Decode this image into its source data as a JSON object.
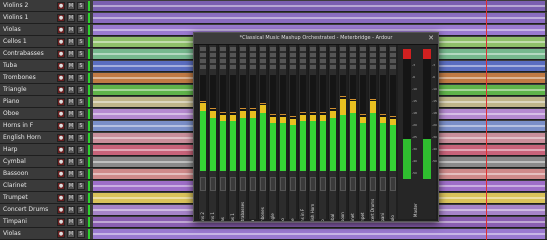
{
  "tracks": [
    {
      "name": "Violins 2",
      "lane_color": "#7a5fb0"
    },
    {
      "name": "Violins 1",
      "lane_color": "#8a6cc0"
    },
    {
      "name": "Violas",
      "lane_color": "#9a7ad0"
    },
    {
      "name": "Cellos 1",
      "lane_color": "#8fbf6a"
    },
    {
      "name": "Contrabasses",
      "lane_color": "#76b88e"
    },
    {
      "name": "Tuba",
      "lane_color": "#5a6dc0"
    },
    {
      "name": "Trombones",
      "lane_color": "#c07a44"
    },
    {
      "name": "Triangle",
      "lane_color": "#5fb34a"
    },
    {
      "name": "Piano",
      "lane_color": "#bfb58a"
    },
    {
      "name": "Oboe",
      "lane_color": "#b58ad0"
    },
    {
      "name": "Horns in F",
      "lane_color": "#7a8ec8"
    },
    {
      "name": "English Horn",
      "lane_color": "#c98f9b"
    },
    {
      "name": "Harp",
      "lane_color": "#c8637a"
    },
    {
      "name": "Cymbal",
      "lane_color": "#8a8a8a"
    },
    {
      "name": "Bassoon",
      "lane_color": "#cf8a8a"
    },
    {
      "name": "Clarinet",
      "lane_color": "#9e6ec8"
    },
    {
      "name": "Trumpet",
      "lane_color": "#d9c25a"
    },
    {
      "name": "Concert Drums",
      "lane_color": "#a684c8"
    },
    {
      "name": "Timpani",
      "lane_color": "#8a5fb0"
    },
    {
      "name": "Violas",
      "lane_color": "#9a7ad0"
    }
  ],
  "track_buttons": {
    "mute": "M",
    "solo": "S",
    "rec": "●"
  },
  "mixer": {
    "title": "*Classical Music Mashup Orchestrated - Meterbridge - Ardour",
    "close": "✕",
    "strips": [
      {
        "name": "Violins 2",
        "level": 0.62,
        "peak": 0.7
      },
      {
        "name": "Violins 1",
        "level": 0.55,
        "peak": 0.62
      },
      {
        "name": "Violas",
        "level": 0.52,
        "peak": 0.58
      },
      {
        "name": "Cellos 1",
        "level": 0.52,
        "peak": 0.58
      },
      {
        "name": "Contrabasses",
        "level": 0.55,
        "peak": 0.62
      },
      {
        "name": "Tuba",
        "level": 0.55,
        "peak": 0.62
      },
      {
        "name": "Trombones",
        "level": 0.6,
        "peak": 0.68
      },
      {
        "name": "Triangle",
        "level": 0.5,
        "peak": 0.56
      },
      {
        "name": "Piano",
        "level": 0.5,
        "peak": 0.56
      },
      {
        "name": "Oboe",
        "level": 0.48,
        "peak": 0.54
      },
      {
        "name": "Horns in F",
        "level": 0.52,
        "peak": 0.58
      },
      {
        "name": "English Horn",
        "level": 0.52,
        "peak": 0.58
      },
      {
        "name": "Harp",
        "level": 0.52,
        "peak": 0.58
      },
      {
        "name": "Cymbal",
        "level": 0.55,
        "peak": 0.62
      },
      {
        "name": "Bassoon",
        "level": 0.58,
        "peak": 0.75
      },
      {
        "name": "Clarinet",
        "level": 0.6,
        "peak": 0.72
      },
      {
        "name": "Trumpet",
        "level": 0.5,
        "peak": 0.56
      },
      {
        "name": "Concert Drums",
        "level": 0.6,
        "peak": 0.72
      },
      {
        "name": "Timpani",
        "level": 0.5,
        "peak": 0.56
      },
      {
        "name": "Piccolo",
        "level": 0.48,
        "peak": 0.54
      }
    ],
    "master": {
      "name": "Master"
    },
    "scale_left": [
      "-3",
      "-6",
      "-10",
      "-15",
      "-18",
      "-20",
      "-25",
      "-30",
      "-40",
      "-50"
    ],
    "scale_right": [
      "-3",
      "-6",
      "-10",
      "-15",
      "-18",
      "-20",
      "-30",
      "-40",
      "-50"
    ]
  },
  "colors": {
    "meter_green": "#35d435",
    "meter_yellow": "#e8c020",
    "playhead": "#e03030"
  }
}
